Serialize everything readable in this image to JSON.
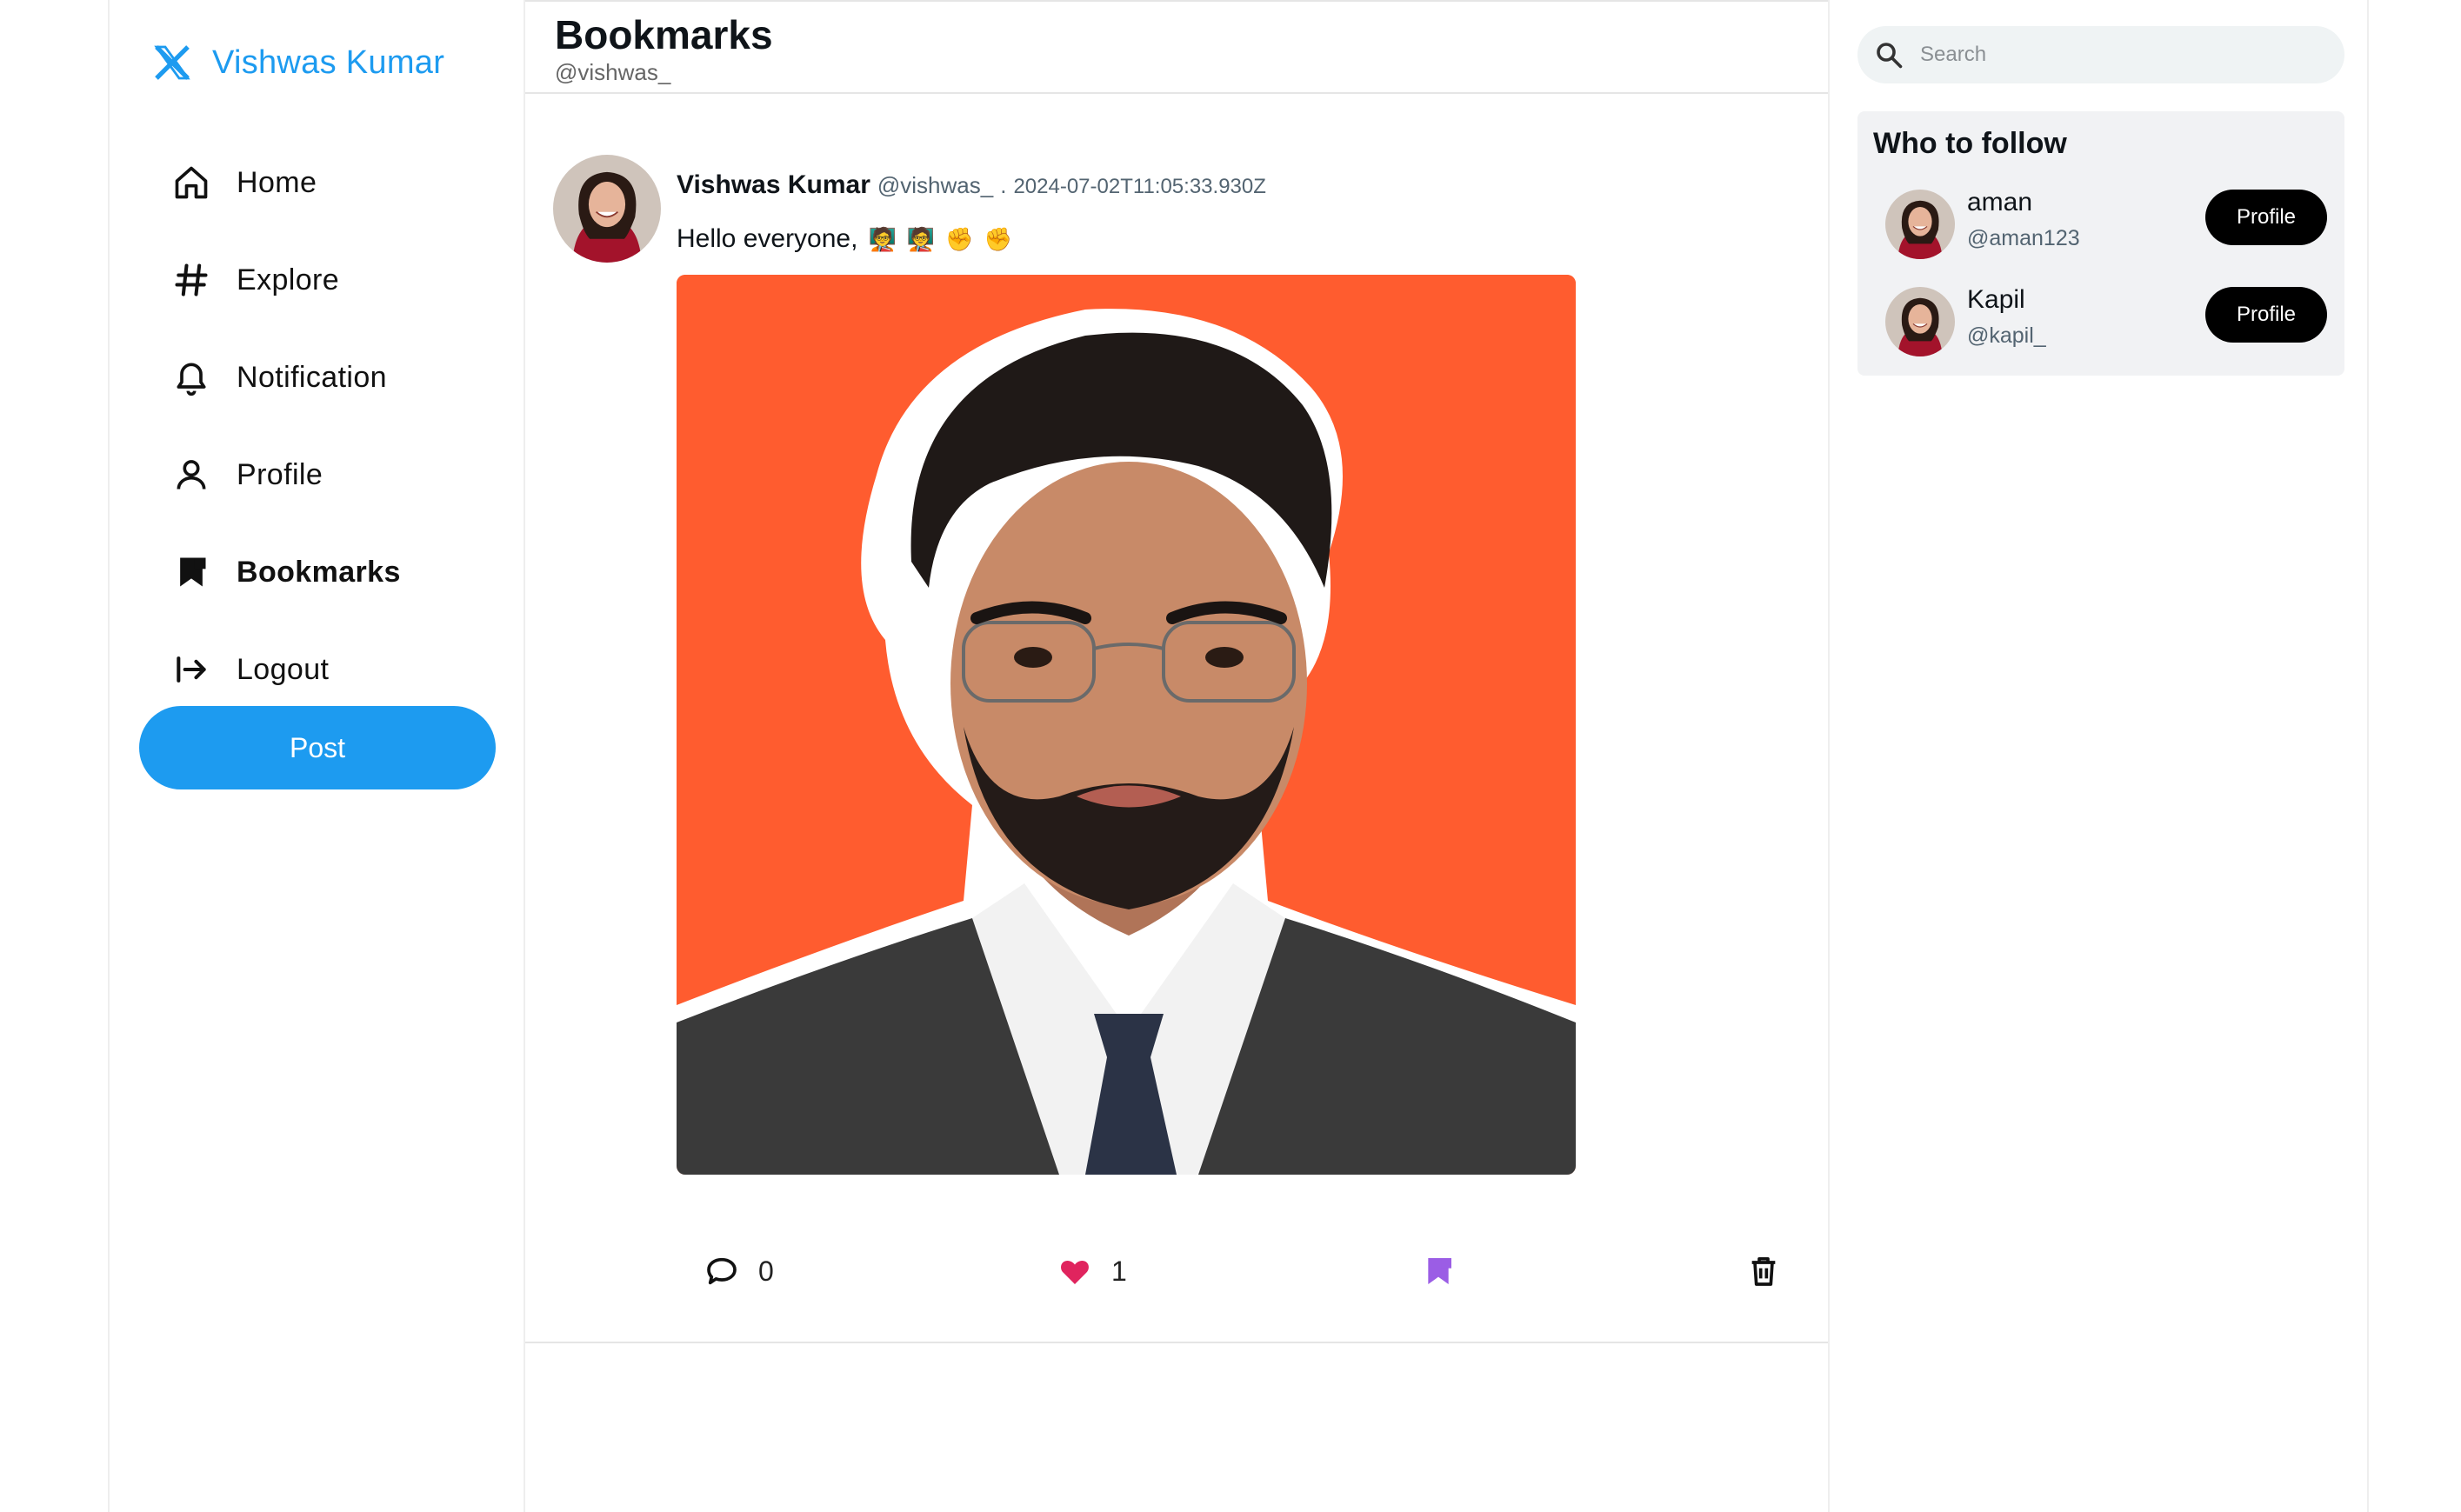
{
  "sidebar": {
    "brand_name": "Vishwas Kumar",
    "items": [
      {
        "label": "Home",
        "icon": "home-icon"
      },
      {
        "label": "Explore",
        "icon": "hashtag-icon"
      },
      {
        "label": "Notification",
        "icon": "bell-icon"
      },
      {
        "label": "Profile",
        "icon": "user-icon"
      },
      {
        "label": "Bookmarks",
        "icon": "bookmark-icon",
        "active": true
      },
      {
        "label": "Logout",
        "icon": "logout-icon"
      }
    ],
    "post_label": "Post"
  },
  "main": {
    "title": "Bookmarks",
    "subtitle": "@vishwas_"
  },
  "tweet": {
    "name": "Vishwas Kumar",
    "handle": "@vishwas_",
    "separator": ".",
    "date": "2024-07-02T11:05:33.930Z",
    "text": "Hello everyone,",
    "emojis": [
      "🧑‍🏫",
      "🧑‍🏫",
      "✊",
      "✊"
    ],
    "comments": "0",
    "likes": "1"
  },
  "right": {
    "search_placeholder": "Search",
    "who_to_follow_title": "Who to follow",
    "suggestions": [
      {
        "name": "aman",
        "handle": "@aman123",
        "button": "Profile"
      },
      {
        "name": "Kapil",
        "handle": "@kapil_",
        "button": "Profile"
      }
    ]
  },
  "colors": {
    "brand": "#1d9bf0",
    "like": "#e0245e",
    "bookmark": "#9b5de5",
    "image_bg": "#ff5c2f"
  }
}
